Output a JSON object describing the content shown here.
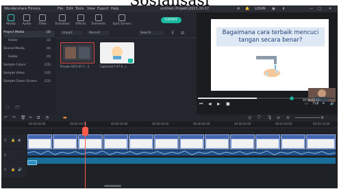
{
  "page_caption": "Sosialisasi",
  "titlebar": {
    "app_name": "Wondershare Filmora",
    "menus": [
      "File",
      "Edit",
      "Tools",
      "View",
      "Export",
      "Help"
    ],
    "project": "untitled (Projekt)2021-10-17",
    "login": "LOGIN"
  },
  "toolbar": {
    "items": [
      "Media",
      "Audio",
      "Titles",
      "Transition",
      "Effects",
      "Elements",
      "Split Screen"
    ],
    "export_label": "EXPORT"
  },
  "sidebar": {
    "items": [
      {
        "label": "Project Media",
        "count": "(2)"
      },
      {
        "label": "Folder",
        "count": "(2)"
      },
      {
        "label": "Shared Media",
        "count": "(0)"
      },
      {
        "label": "Folder",
        "count": "(0)"
      },
      {
        "label": "Sample Colors",
        "count": "(15)"
      },
      {
        "label": "Sample Video",
        "count": "(20)"
      },
      {
        "label": "Sample Green Screen",
        "count": "(12)"
      }
    ]
  },
  "media": {
    "import_label": "Import",
    "record_label": "Record",
    "search_placeholder": "Search",
    "thumbs": [
      {
        "caption": "Private 2021-07-1...1"
      },
      {
        "caption": "Capture(17-07-2...)"
      }
    ]
  },
  "preview": {
    "slide_text": "Bagaimana cara terbaik mencuci tangan secara benar?",
    "progress": 0.43,
    "timecode": "00:00:07:11",
    "quality": "Full",
    "quality_icon": "monitor-icon"
  },
  "timeline": {
    "ruler": [
      "00:00:00:00",
      "00:00:10:00",
      "00:00:20:00",
      "00:00:30:00",
      "00:00:40:00",
      "00:00:50:00",
      "00:01:00:00",
      "00:01:10:00",
      "00:01:20:00"
    ],
    "track_labels": [
      "2",
      "1",
      "1"
    ],
    "subtitle_clip": "Caption"
  },
  "colors": {
    "accent": "#19b9a3",
    "playhead": "#ff5a4a",
    "clip": "#6c8fd6"
  }
}
